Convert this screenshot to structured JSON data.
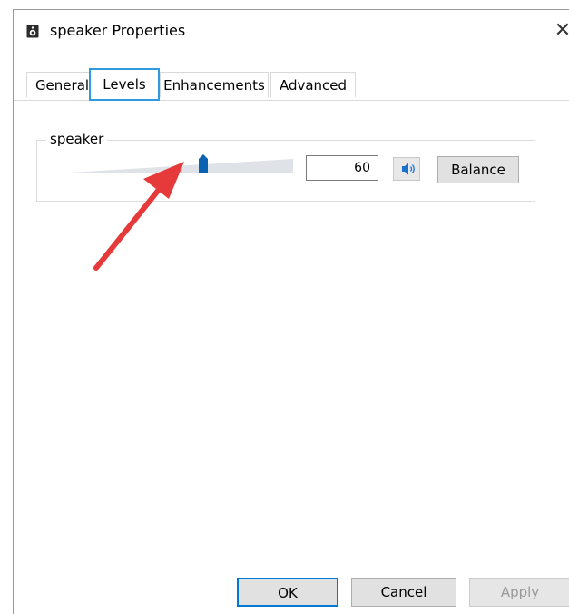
{
  "window": {
    "title": "speaker Properties",
    "close_label": "✕"
  },
  "tabs": [
    {
      "label": "General"
    },
    {
      "label": "Levels"
    },
    {
      "label": "Enhancements"
    },
    {
      "label": "Advanced"
    }
  ],
  "levels": {
    "group_label": "speaker",
    "volume_value": "60",
    "slider_level_percent": 60,
    "balance_label": "Balance",
    "speaker_icon": "speaker-icon"
  },
  "footer": {
    "ok_label": "OK",
    "cancel_label": "Cancel",
    "apply_label": "Apply"
  },
  "colors": {
    "accent": "#0078d7",
    "tab_highlight": "#2f9ae0",
    "annotation_arrow": "#e63a3a"
  }
}
